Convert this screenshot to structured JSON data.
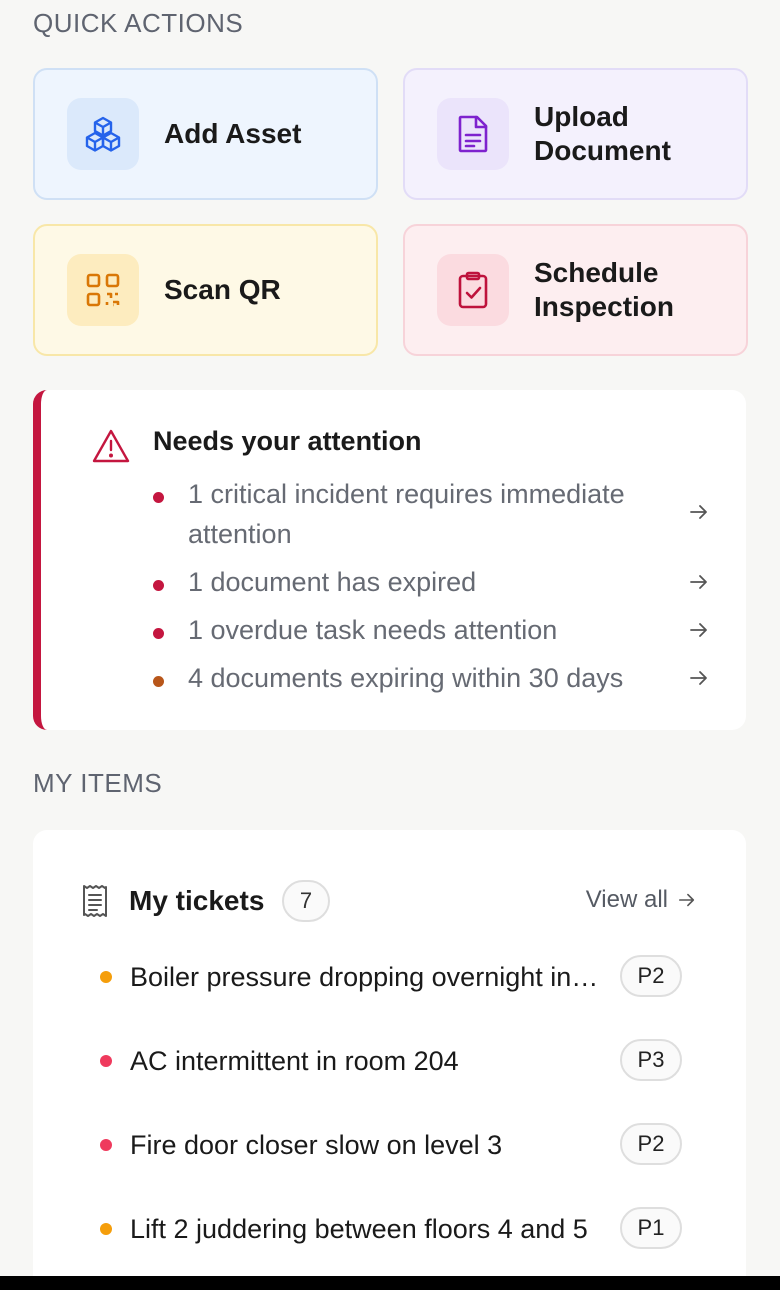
{
  "quick_actions": {
    "title": "QUICK ACTIONS",
    "cards": [
      {
        "label": "Add Asset",
        "icon": "cubes-icon"
      },
      {
        "label": "Upload Document",
        "icon": "document-icon"
      },
      {
        "label": "Scan QR",
        "icon": "qr-code-icon"
      },
      {
        "label": "Schedule Inspection",
        "icon": "clipboard-check-icon"
      }
    ]
  },
  "attention": {
    "title": "Needs your attention",
    "items": [
      {
        "text": "1 critical incident requires immediate attention",
        "severity_color": "#c4163f"
      },
      {
        "text": "1 document has expired",
        "severity_color": "#c4163f"
      },
      {
        "text": "1 overdue task needs attention",
        "severity_color": "#c4163f"
      },
      {
        "text": "4 documents expiring within 30 days",
        "severity_color": "#b8561a"
      }
    ]
  },
  "my_items": {
    "title": "MY ITEMS",
    "tickets": {
      "title": "My tickets",
      "count": "7",
      "view_all": "View all",
      "rows": [
        {
          "title": "Boiler pressure dropping overnight in plant room",
          "priority": "P2",
          "status_color": "#f59e0b"
        },
        {
          "title": "AC intermittent in room 204",
          "priority": "P3",
          "status_color": "#ef3a5d"
        },
        {
          "title": "Fire door closer slow on level 3",
          "priority": "P2",
          "status_color": "#ef3a5d"
        },
        {
          "title": "Lift 2 juddering between floors 4 and 5",
          "priority": "P1",
          "status_color": "#f59e0b"
        }
      ]
    }
  },
  "colors": {
    "accent_red": "#c4163f",
    "background": "#f7f7f5"
  }
}
